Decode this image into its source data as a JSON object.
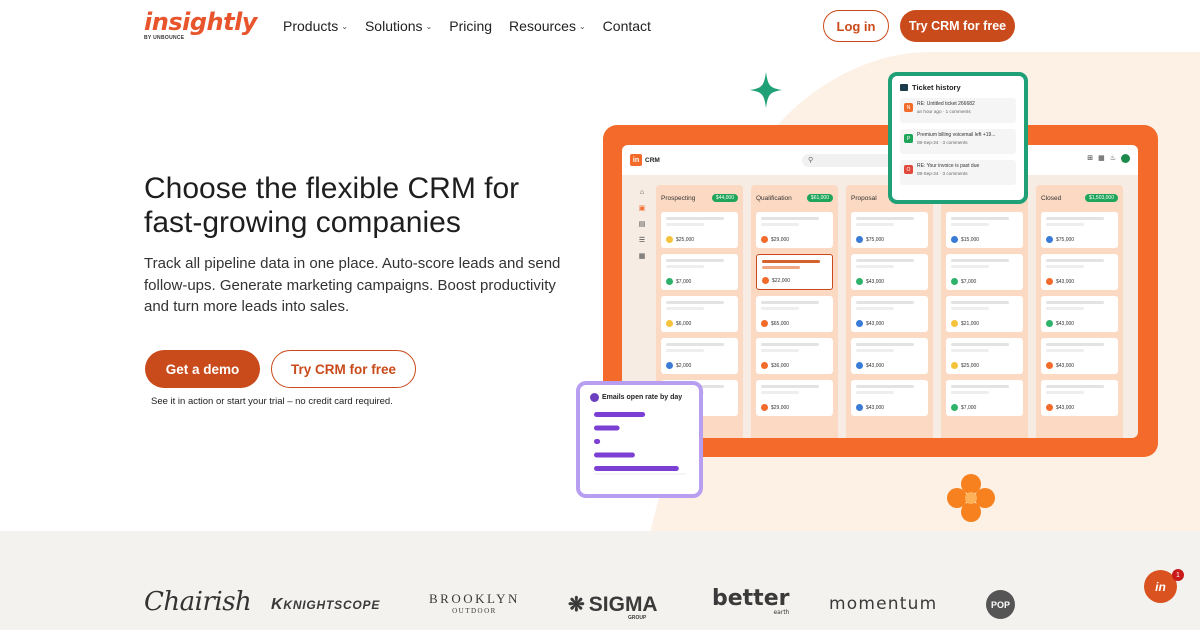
{
  "brand": {
    "name": "insightly",
    "byline": "BY UNBOUNCE"
  },
  "nav": {
    "items": [
      {
        "label": "Products",
        "has_caret": true
      },
      {
        "label": "Solutions",
        "has_caret": true
      },
      {
        "label": "Pricing",
        "has_caret": false
      },
      {
        "label": "Resources",
        "has_caret": true
      },
      {
        "label": "Contact",
        "has_caret": false
      }
    ],
    "login": "Log in",
    "cta": "Try CRM for free",
    "caret_glyph": "⌄"
  },
  "hero": {
    "title": "Choose the flexible CRM for fast-growing companies",
    "subtitle": "Track all pipeline data in one place. Auto-score leads and send follow-ups. Generate marketing campaigns. Boost productivity and turn more leads into sales.",
    "primary_cta": "Get a demo",
    "secondary_cta": "Try CRM for free",
    "note": "See it in action or start your trial – no credit card required."
  },
  "mockup": {
    "app_name": "CRM",
    "app_badge": "in",
    "columns": [
      {
        "name": "Prospecting",
        "total": "$44,000",
        "cards": [
          {
            "value": "$25,000",
            "color": "#f5c33b"
          },
          {
            "value": "$7,000",
            "color": "#2fb36b"
          },
          {
            "value": "$6,000",
            "color": "#f5c33b"
          },
          {
            "value": "$2,000",
            "color": "#3a7bd5"
          },
          {
            "value": "$4,000",
            "color": "#f5c33b"
          }
        ]
      },
      {
        "name": "Qualification",
        "total": "$61,000",
        "cards": [
          {
            "value": "$29,000",
            "color": "#f26b2b"
          },
          {
            "value": "$22,000",
            "color": "#f26b2b",
            "highlight": true
          },
          {
            "value": "$65,000",
            "color": "#f26b2b"
          },
          {
            "value": "$36,000",
            "color": "#f26b2b"
          },
          {
            "value": "$29,000",
            "color": "#f26b2b"
          }
        ]
      },
      {
        "name": "Proposal",
        "total": "",
        "cards": [
          {
            "value": "$75,000",
            "color": "#3a7bd5"
          },
          {
            "value": "$43,000",
            "color": "#2fb36b"
          },
          {
            "value": "$43,000",
            "color": "#3a7bd5"
          },
          {
            "value": "$43,000",
            "color": "#3a7bd5"
          },
          {
            "value": "$43,000",
            "color": "#3a7bd5"
          }
        ]
      },
      {
        "name": "",
        "total": "",
        "cards": [
          {
            "value": "$15,000",
            "color": "#3a7bd5"
          },
          {
            "value": "$7,000",
            "color": "#2fb36b"
          },
          {
            "value": "$21,000",
            "color": "#f5c33b"
          },
          {
            "value": "$25,000",
            "color": "#f5c33b"
          },
          {
            "value": "$7,000",
            "color": "#2fb36b"
          }
        ]
      },
      {
        "name": "Closed",
        "total": "$1,503,000",
        "cards": [
          {
            "value": "$75,000",
            "color": "#3a7bd5"
          },
          {
            "value": "$43,000",
            "color": "#f26b2b"
          },
          {
            "value": "$43,000",
            "color": "#2fb36b"
          },
          {
            "value": "$43,000",
            "color": "#f26b2b"
          },
          {
            "value": "$43,000",
            "color": "#f26b2b"
          }
        ]
      }
    ],
    "ticket_history": {
      "title": "Ticket history",
      "items": [
        {
          "icon": "N",
          "color": "#f26b2b",
          "text": "RE: Untitled ticket 266682",
          "meta": "an hour ago · 1 comments"
        },
        {
          "icon": "P",
          "color": "#1fa55a",
          "text": "Premium billing voicemail left +19...",
          "meta": "08-Sep-24 · 3 comments"
        },
        {
          "icon": "O",
          "color": "#e0493b",
          "text": "RE: Your invoice is past due",
          "meta": "08-Sep-24 · 3 comments"
        }
      ]
    },
    "emails_chart": {
      "title": "Emails open rate by day",
      "bar_color": "#7b3fd4"
    }
  },
  "chart_data": {
    "type": "bar",
    "title": "Emails open rate by day",
    "orientation": "horizontal",
    "categories": [
      "",
      "",
      "",
      "",
      ""
    ],
    "values": [
      50,
      25,
      6,
      40,
      83
    ],
    "xlim": [
      0,
      90
    ],
    "grid": false
  },
  "customers": [
    {
      "name": "Chairish"
    },
    {
      "name": "KNIGHTSCOPE"
    },
    {
      "name": "BROOKLYN",
      "sub": "OUTDOOR"
    },
    {
      "name": "SIGMA",
      "sub": "GROUP"
    },
    {
      "name": "better",
      "sub": "earth"
    },
    {
      "name": "momentum"
    },
    {
      "name": "POP"
    }
  ],
  "chat": {
    "badge": "1",
    "label": "in"
  },
  "colors": {
    "brand_orange": "#c94a1a",
    "frame_orange": "#f36a2b",
    "green": "#1fa076",
    "purple": "#b79ef0"
  }
}
